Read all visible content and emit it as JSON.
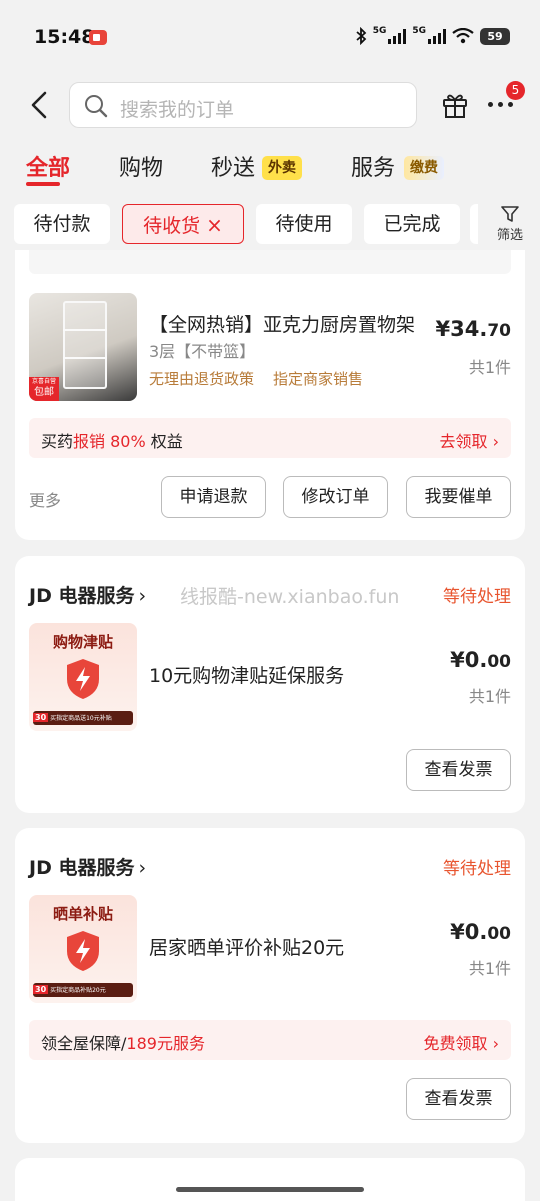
{
  "status_bar": {
    "time": "15:48",
    "signal_label_1": "5G",
    "signal_label_2": "5G",
    "battery": "59"
  },
  "header": {
    "search_placeholder": "搜索我的订单",
    "notification_count": "5"
  },
  "tabs": [
    {
      "label": "全部"
    },
    {
      "label": "购物"
    },
    {
      "label": "秒送",
      "tag": "外卖"
    },
    {
      "label": "服务",
      "tag": "缴费"
    }
  ],
  "filters": {
    "chips": [
      {
        "label": "待付款"
      },
      {
        "label": "待收货",
        "close": "×"
      },
      {
        "label": "待使用"
      },
      {
        "label": "已完成"
      }
    ],
    "filter_label": "筛选"
  },
  "order1": {
    "thumb_badge_1": "京喜自营",
    "thumb_badge_2": "包邮",
    "title": "【全网热销】亚克力厨房置物架",
    "spec": "3层【不带篮】",
    "tags": [
      "无理由退货政策",
      "指定商家销售"
    ],
    "price_main": "¥34.",
    "price_cents": "70",
    "quantity": "共1件",
    "promo_prefix": "买药",
    "promo_highlight": "报销 80%",
    "promo_suffix": " 权益",
    "promo_link": "去领取",
    "more": "更多",
    "buttons": [
      "申请退款",
      "修改订单",
      "我要催单"
    ]
  },
  "order2": {
    "shop": "JD 电器服务",
    "watermark": "线报酷-new.xianbao.fun",
    "status": "等待处理",
    "thumb_title": "购物津贴",
    "thumb_days": "30",
    "thumb_note": "买指定商品送10元补贴",
    "title": "10元购物津贴延保服务",
    "price_main": "¥0.",
    "price_cents": "00",
    "quantity": "共1件",
    "button": "查看发票"
  },
  "order3": {
    "shop": "JD 电器服务",
    "status": "等待处理",
    "thumb_title": "晒单补贴",
    "thumb_days": "30",
    "thumb_note": "买指定商品补贴20元",
    "title": "居家晒单评价补贴20元",
    "price_main": "¥0.",
    "price_cents": "00",
    "quantity": "共1件",
    "promo_prefix": "领全屋保障/",
    "promo_highlight": "189元服务",
    "promo_link": "免费领取",
    "button": "查看发票"
  },
  "colors": {
    "accent": "#e5262b",
    "status": "#e8552f",
    "tag": "#b87c3a"
  }
}
